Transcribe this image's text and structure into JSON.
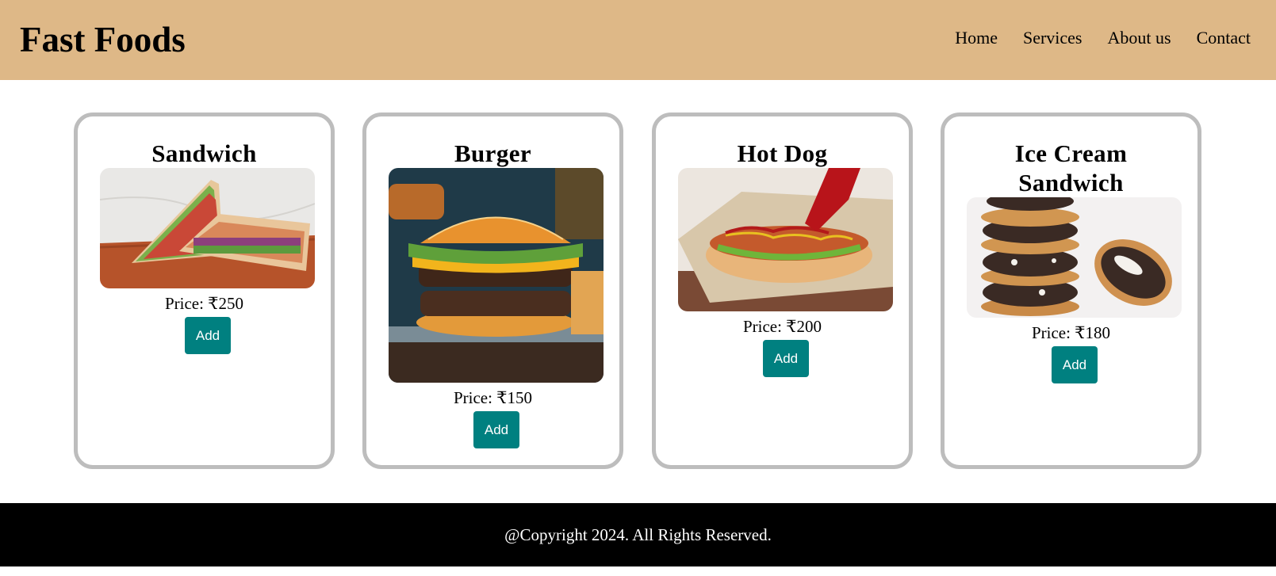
{
  "header": {
    "brand": "Fast Foods",
    "nav": [
      "Home",
      "Services",
      "About us",
      "Contact"
    ]
  },
  "products": [
    {
      "name": "Sandwich",
      "price": "Price: ₹250",
      "button": "Add"
    },
    {
      "name": "Burger",
      "price": "Price: ₹150",
      "button": "Add"
    },
    {
      "name": "Hot Dog",
      "price": "Price: ₹200",
      "button": "Add"
    },
    {
      "name": "Ice Cream\nSandwich",
      "price": "Price: ₹180",
      "button": "Add"
    }
  ],
  "footer": {
    "copyright": "@Copyright 2024. All Rights Reserved."
  },
  "colors": {
    "header_bg": "#deb887",
    "button_bg": "#008080",
    "card_border": "#bdbdbd",
    "footer_bg": "#000000"
  }
}
